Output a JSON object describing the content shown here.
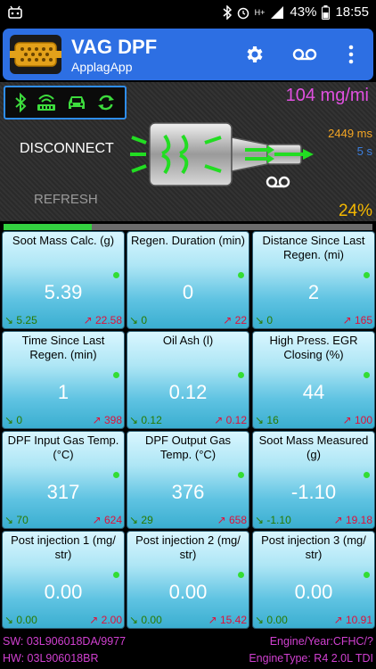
{
  "status_bar": {
    "left_icon": "usb-debug-icon",
    "battery": "43%",
    "time": "18:55",
    "network": "H+"
  },
  "app_bar": {
    "title": "VAG DPF",
    "subtitle": "ApplagApp",
    "icons": [
      "settings-gear-icon",
      "voicemail-icon",
      "overflow-menu-icon"
    ]
  },
  "dashboard": {
    "concentration": "104 mg/mi",
    "disconnect_label": "DISCONNECT",
    "refresh_label": "REFRESH",
    "response_time": "2449 ms",
    "interval": "5 s",
    "percent": "24%",
    "progress": 0.24,
    "status_icons": [
      "bluetooth-icon",
      "adapter-icon",
      "car-icon",
      "sync-icon"
    ]
  },
  "tiles": [
    {
      "label": "Soot Mass Calc. (g)",
      "value": "5.39",
      "min": "5.25",
      "max": "22.58"
    },
    {
      "label": "Regen. Duration (min)",
      "value": "0",
      "min": "0",
      "max": "22"
    },
    {
      "label": "Distance Since Last Regen. (mi)",
      "value": "2",
      "min": "0",
      "max": "165"
    },
    {
      "label": "Time Since Last Regen. (min)",
      "value": "1",
      "min": "0",
      "max": "398"
    },
    {
      "label": "Oil Ash (l)",
      "value": "0.12",
      "min": "0.12",
      "max": "0.12"
    },
    {
      "label": "High Press. EGR Closing (%)",
      "value": "44",
      "min": "16",
      "max": "100"
    },
    {
      "label": "DPF Input Gas Temp. (°C)",
      "value": "317",
      "min": "70",
      "max": "624"
    },
    {
      "label": "DPF Output Gas Temp. (°C)",
      "value": "376",
      "min": "29",
      "max": "658"
    },
    {
      "label": "Soot Mass Measured (g)",
      "value": "-1.10",
      "min": "-1.10",
      "max": "19.18"
    },
    {
      "label": "Post injection 1 (mg/ str)",
      "value": "0.00",
      "min": "0.00",
      "max": "2.00"
    },
    {
      "label": "Post injection 2 (mg/ str)",
      "value": "0.00",
      "min": "0.00",
      "max": "15.42"
    },
    {
      "label": "Post injection 3 (mg/ str)",
      "value": "0.00",
      "min": "0.00",
      "max": "10.91"
    }
  ],
  "footer": {
    "sw": "SW: 03L906018DA/9977",
    "hw": "HW: 03L906018BR",
    "engine_year": "Engine/Year:CFHC/?",
    "engine_type": "EngineType: R4 2.0L TDI"
  },
  "colors": {
    "accent": "#2d6fe3",
    "concentration": "#e050e0",
    "progress": "#33d140",
    "footer_text": "#d040d0"
  }
}
